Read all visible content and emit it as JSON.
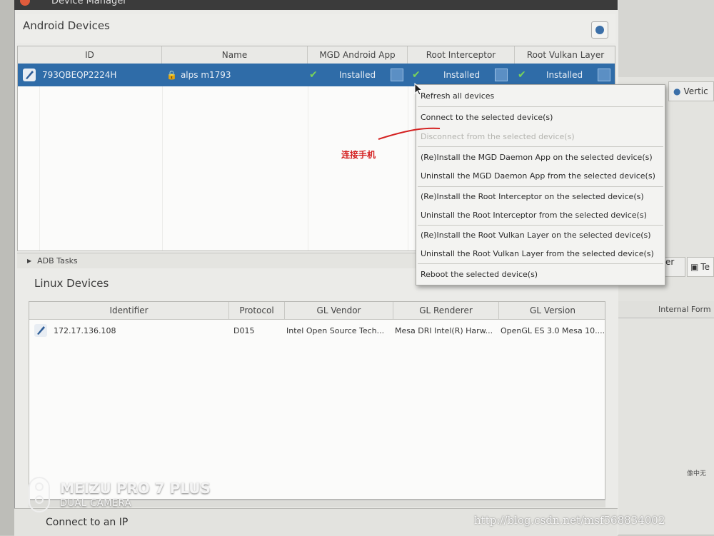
{
  "window": {
    "title": "Device Manager"
  },
  "android": {
    "title": "Android Devices",
    "columns": [
      "ID",
      "Name",
      "MGD Android App",
      "Root Interceptor",
      "Root Vulkan Layer"
    ],
    "row": {
      "id": "793QBEQP2224H",
      "name": "alps m1793",
      "mgd_status": "Installed",
      "root_status": "Installed",
      "vulkan_status": "Installed"
    }
  },
  "adb_tasks_label": "ADB Tasks",
  "linux": {
    "title": "Linux Devices",
    "columns": [
      "Identifier",
      "Protocol",
      "GL Vendor",
      "GL Renderer",
      "GL Version"
    ],
    "row": {
      "identifier": "172.17.136.108",
      "protocol": "D015",
      "gl_vendor": "Intel Open Source Tech...",
      "gl_renderer": "Mesa DRI Intel(R) Harw...",
      "gl_version": "OpenGL ES 3.0 Mesa 10...."
    }
  },
  "connect_ip_label": "Connect to an IP",
  "context_menu": [
    {
      "label": "Refresh all devices",
      "enabled": true
    },
    {
      "label": "Connect to the selected device(s)",
      "enabled": true
    },
    {
      "label": "Disconnect from the selected device(s)",
      "enabled": false
    },
    {
      "label": "(Re)Install the MGD Daemon App on the selected device(s)",
      "enabled": true
    },
    {
      "label": "Uninstall the MGD Daemon App from the selected device(s)",
      "enabled": true
    },
    {
      "label": "(Re)Install the Root Interceptor on the selected device(s)",
      "enabled": true
    },
    {
      "label": "Uninstall the Root Interceptor from the selected device(s)",
      "enabled": true
    },
    {
      "label": "(Re)Install the Root Vulkan Layer on the selected device(s)",
      "enabled": true
    },
    {
      "label": "Uninstall the Root Vulkan Layer from the selected device(s)",
      "enabled": true
    },
    {
      "label": "Reboot the selected device(s)",
      "enabled": true
    }
  ],
  "annotation": {
    "text": "连接手机",
    "color": "#d42020"
  },
  "background": {
    "tab_vertic": "Vertic",
    "tab_ider": "ider ...",
    "tab_te": "Te",
    "internal_header": "Internal Form",
    "small_text": "像中无"
  },
  "watermark": {
    "camera_model": "MEIZU PRO 7 PLUS",
    "camera_sub": "DUAL CAMERA",
    "url": "http://blog.csdn.net/msf568834002"
  },
  "colors": {
    "selection": "#2f6ca8",
    "check": "#7ad35a",
    "accent": "#3b6fa8"
  }
}
